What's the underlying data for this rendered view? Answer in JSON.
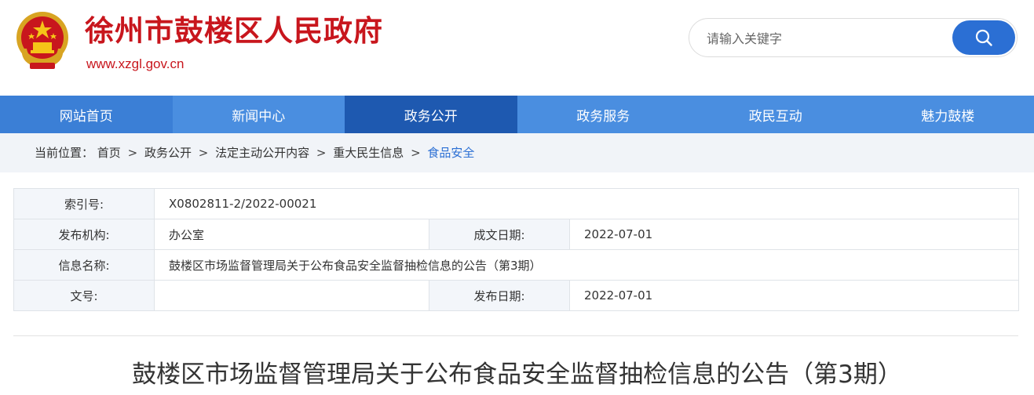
{
  "header": {
    "site_title": "徐州市鼓楼区人民政府",
    "site_url": "www.xzgl.gov.cn",
    "brand_color": "#c8161d",
    "search": {
      "placeholder": "请输入关键字",
      "button_icon": "search-icon",
      "button_color": "#2b6fd4"
    }
  },
  "nav": {
    "items": [
      {
        "label": "网站首页"
      },
      {
        "label": "新闻中心"
      },
      {
        "label": "政务公开"
      },
      {
        "label": "政务服务"
      },
      {
        "label": "政民互动"
      },
      {
        "label": "魅力鼓楼"
      }
    ],
    "active": "政务公开",
    "bar_color": "#4a8ee0",
    "active_color": "#1e59b0"
  },
  "breadcrumb": {
    "prefix": "当前位置：",
    "items": [
      "首页",
      "政务公开",
      "法定主动公开内容",
      "重大民生信息"
    ],
    "current": "食品安全",
    "separator": ">"
  },
  "info": {
    "index_label": "索引号:",
    "index_value": "X0802811-2/2022-00021",
    "publisher_label": "发布机构:",
    "publisher_value": "办公室",
    "created_label": "成文日期:",
    "created_value": "2022-07-01",
    "name_label": "信息名称:",
    "name_value": "鼓楼区市场监督管理局关于公布食品安全监督抽检信息的公告（第3期）",
    "docno_label": "文号:",
    "docno_value": "",
    "published_label": "发布日期:",
    "published_value": "2022-07-01"
  },
  "article": {
    "title": "鼓楼区市场监督管理局关于公布食品安全监督抽检信息的公告（第3期）"
  }
}
